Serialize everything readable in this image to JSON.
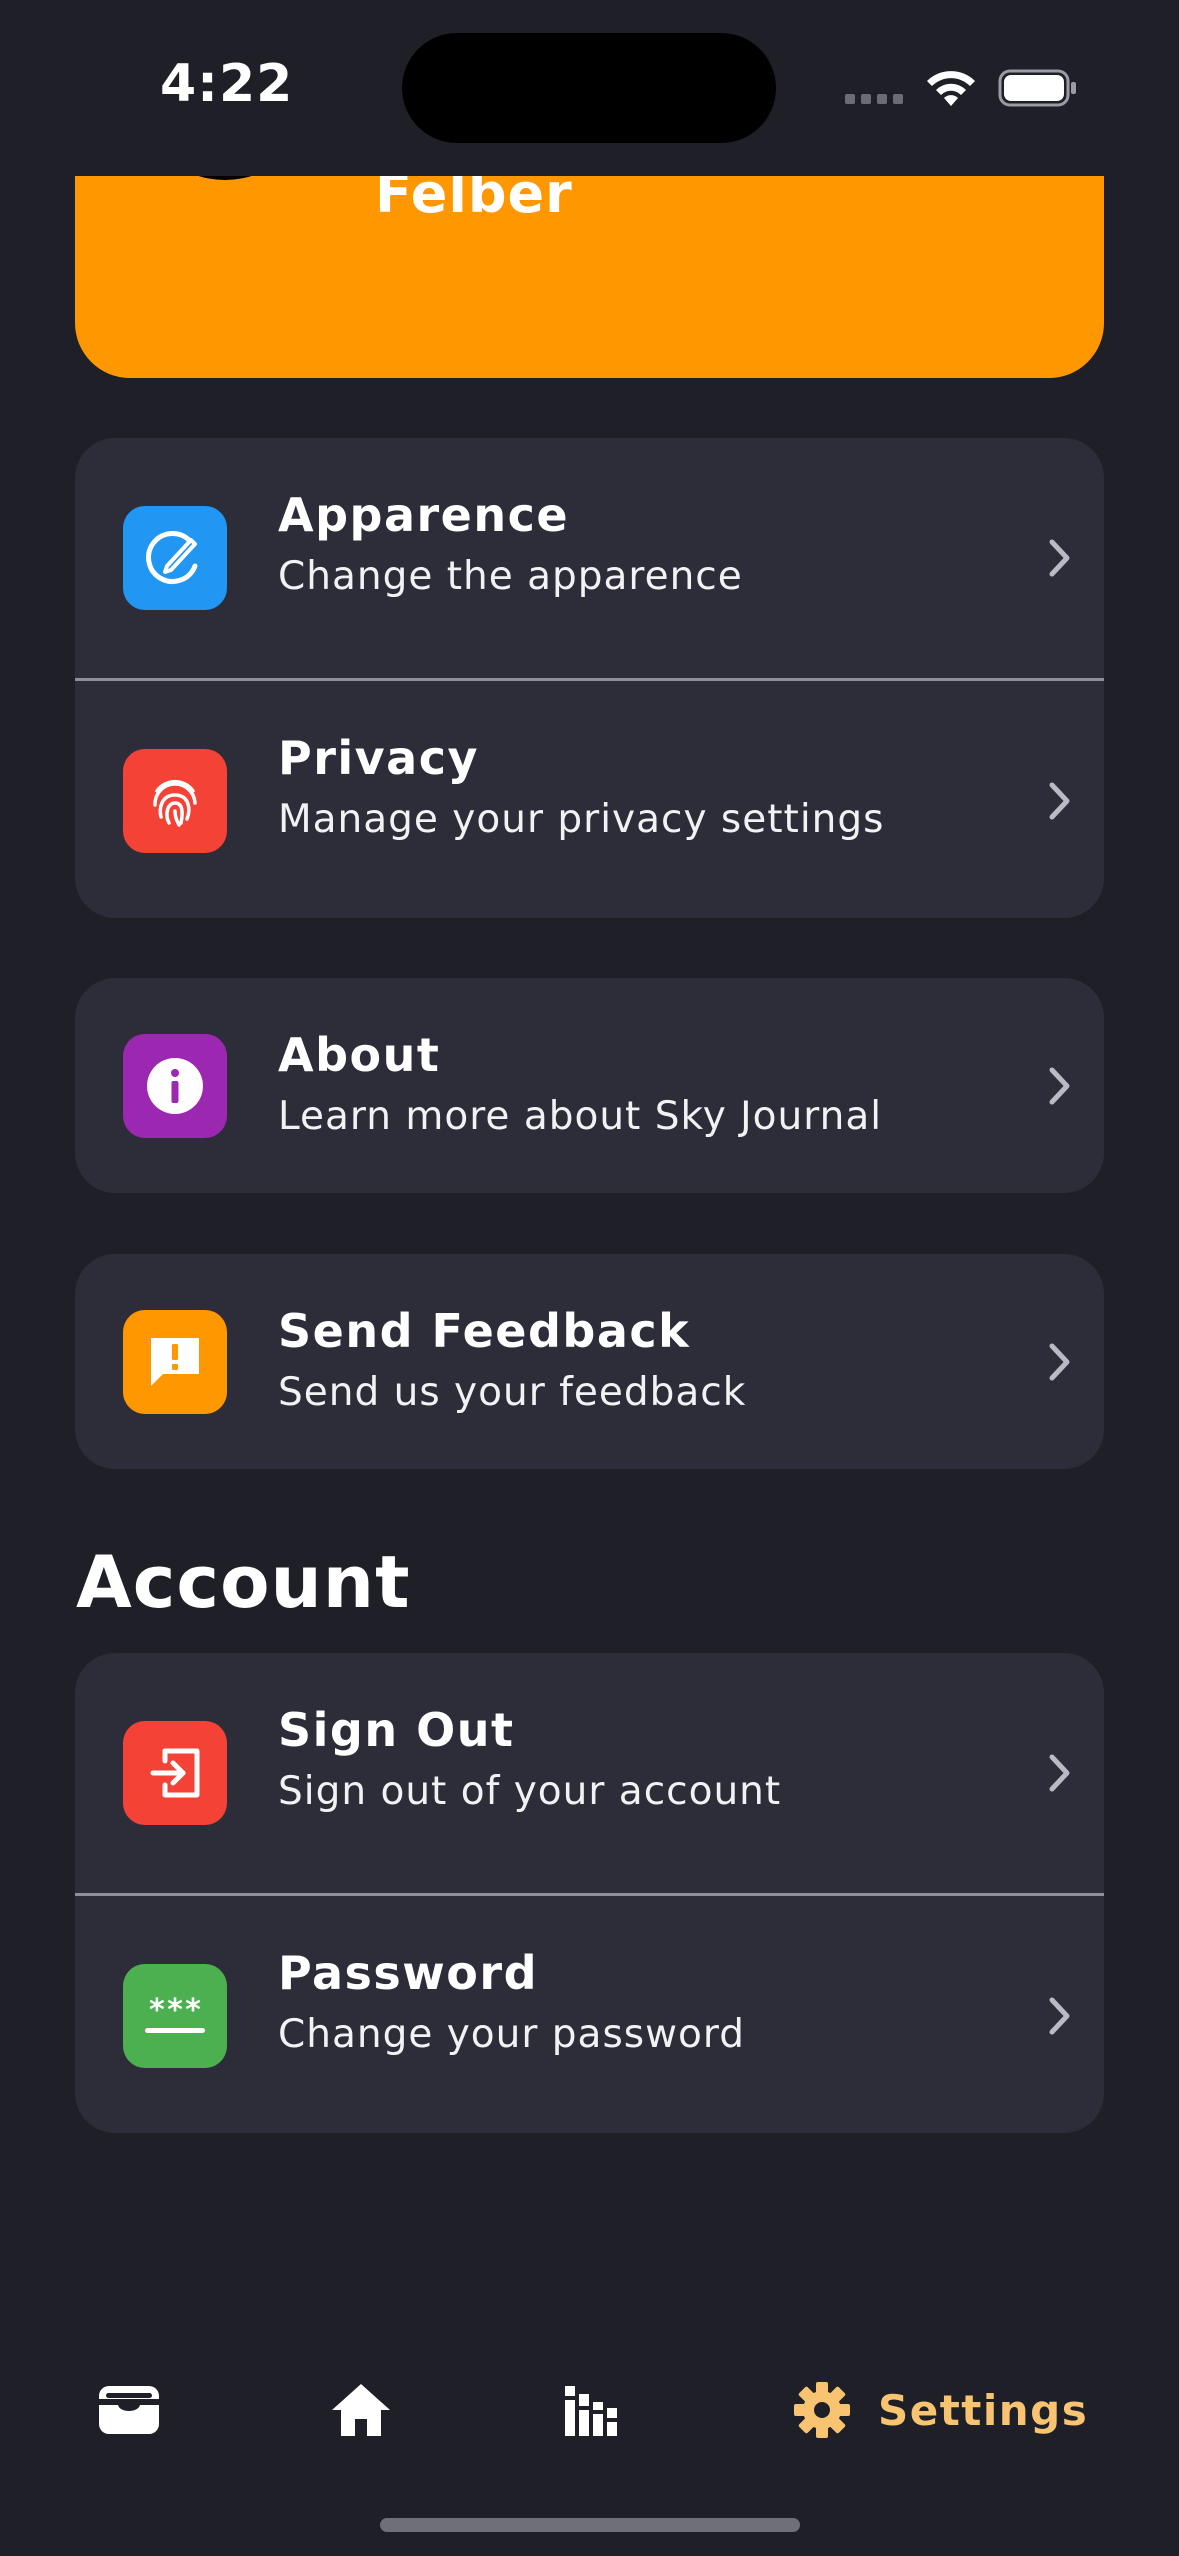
{
  "status_bar": {
    "time": "4:22"
  },
  "profile": {
    "name": "Felber"
  },
  "settings_groups": {
    "appearance": {
      "title": "Apparence",
      "subtitle": "Change the apparence",
      "icon": "palette-icon",
      "color": "#2196f3"
    },
    "privacy": {
      "title": "Privacy",
      "subtitle": "Manage your privacy settings",
      "icon": "fingerprint-icon",
      "color": "#f44336"
    },
    "about": {
      "title": "About",
      "subtitle": "Learn more about Sky Journal",
      "icon": "info-icon",
      "color": "#9c27b0"
    },
    "feedback": {
      "title": "Send Feedback",
      "subtitle": "Send us your feedback",
      "icon": "feedback-icon",
      "color": "#ff9800"
    }
  },
  "account": {
    "section_title": "Account",
    "sign_out": {
      "title": "Sign Out",
      "subtitle": "Sign out of your account",
      "icon": "sign-out-icon",
      "color": "#f44336"
    },
    "password": {
      "title": "Password",
      "subtitle": "Change your password",
      "icon": "password-icon",
      "color": "#4caf50"
    }
  },
  "tab_bar": {
    "tabs": [
      {
        "icon": "wallet-icon",
        "selected": false
      },
      {
        "icon": "home-icon",
        "selected": false
      },
      {
        "icon": "stats-icon",
        "selected": false
      },
      {
        "icon": "gear-icon",
        "label": "Settings",
        "selected": true
      }
    ],
    "active_color": "#f8c471",
    "inactive_color": "#ffffff"
  }
}
